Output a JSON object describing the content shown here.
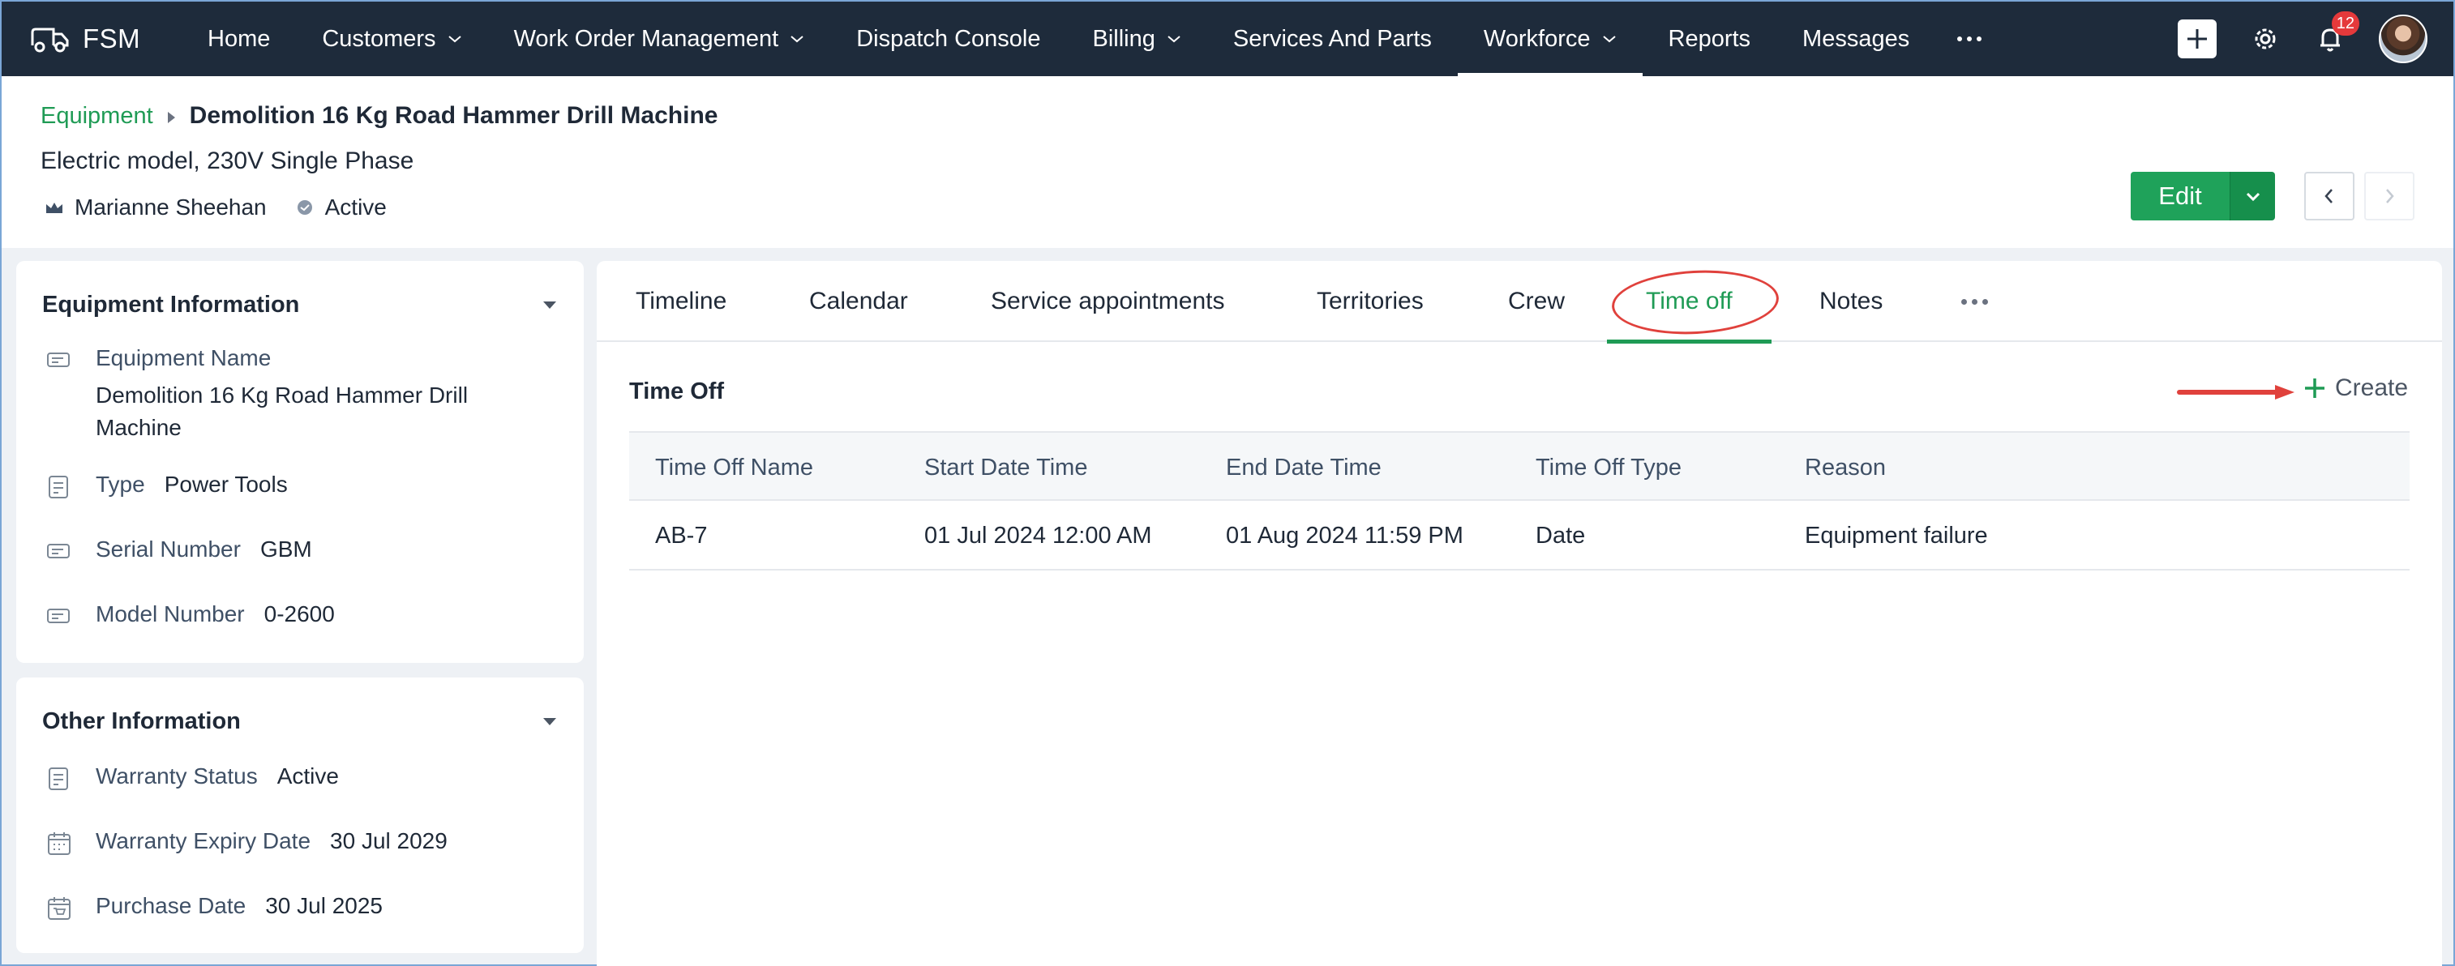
{
  "app": {
    "brand": "FSM",
    "nav": [
      {
        "label": "Home",
        "dropdown": false
      },
      {
        "label": "Customers",
        "dropdown": true
      },
      {
        "label": "Work Order Management",
        "dropdown": true
      },
      {
        "label": "Dispatch Console",
        "dropdown": false
      },
      {
        "label": "Billing",
        "dropdown": true
      },
      {
        "label": "Services And Parts",
        "dropdown": false
      },
      {
        "label": "Workforce",
        "dropdown": true,
        "active": true
      },
      {
        "label": "Reports",
        "dropdown": false
      },
      {
        "label": "Messages",
        "dropdown": false
      }
    ],
    "notifications_count": "12"
  },
  "header": {
    "breadcrumb_link": "Equipment",
    "title": "Demolition 16 Kg Road Hammer Drill Machine",
    "subtitle": "Electric model, 230V Single Phase",
    "owner": "Marianne Sheehan",
    "status": "Active",
    "edit_label": "Edit"
  },
  "equipment_info": {
    "title": "Equipment Information",
    "fields": [
      {
        "label": "Equipment Name",
        "value": "Demolition 16 Kg Road Hammer Drill Machine"
      },
      {
        "label": "Type",
        "value": "Power Tools"
      },
      {
        "label": "Serial Number",
        "value": "GBM"
      },
      {
        "label": "Model Number",
        "value": "0-2600"
      }
    ]
  },
  "other_info": {
    "title": "Other Information",
    "fields": [
      {
        "label": "Warranty Status",
        "value": "Active"
      },
      {
        "label": "Warranty Expiry Date",
        "value": "30 Jul 2029"
      },
      {
        "label": "Purchase Date",
        "value": "30 Jul 2025"
      }
    ]
  },
  "tabs": [
    {
      "label": "Timeline"
    },
    {
      "label": "Calendar"
    },
    {
      "label": "Service appointments"
    },
    {
      "label": "Territories"
    },
    {
      "label": "Crew"
    },
    {
      "label": "Time off",
      "active": true
    },
    {
      "label": "Notes"
    }
  ],
  "time_off": {
    "title": "Time Off",
    "create_label": "Create",
    "columns": [
      "Time Off Name",
      "Start Date Time",
      "End Date Time",
      "Time Off Type",
      "Reason"
    ],
    "rows": [
      [
        "AB-7",
        "01 Jul 2024 12:00 AM",
        "01 Aug 2024 11:59 PM",
        "Date",
        "Equipment failure"
      ]
    ]
  },
  "colors": {
    "nav_bg": "#1e2b3b",
    "accent_green": "#1f9b55",
    "annotation_red": "#e0413c"
  }
}
